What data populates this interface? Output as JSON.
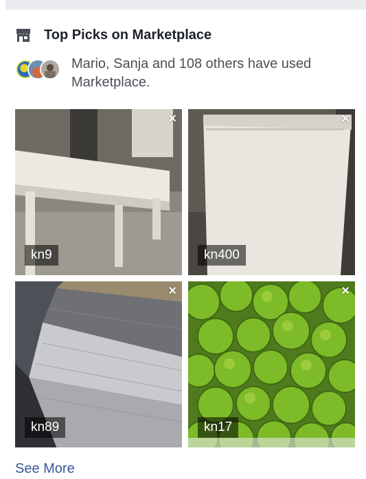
{
  "header": {
    "title": "Top Picks on Marketplace",
    "icon": "store-icon"
  },
  "social": {
    "text": "Mario, Sanja and 108 others have used Marketplace."
  },
  "items": [
    {
      "price": "kn9",
      "close": "×"
    },
    {
      "price": "kn400",
      "close": "×"
    },
    {
      "price": "kn89",
      "close": "×"
    },
    {
      "price": "kn17",
      "close": "×"
    }
  ],
  "footer": {
    "see_more": "See More"
  },
  "colors": {
    "link": "#365899",
    "title": "#1d2129",
    "divider": "#e9ebee"
  }
}
